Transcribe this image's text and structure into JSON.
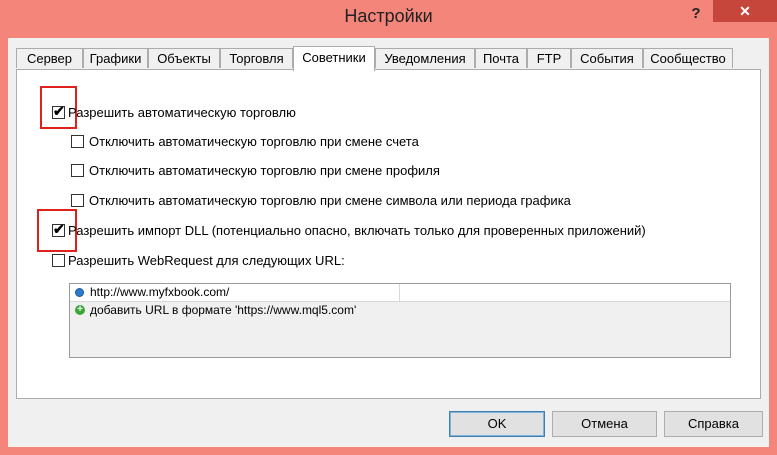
{
  "window": {
    "title": "Настройки",
    "help_label": "?",
    "close_label": "✕"
  },
  "tabs": [
    {
      "label": "Сервер"
    },
    {
      "label": "Графики"
    },
    {
      "label": "Объекты"
    },
    {
      "label": "Торговля"
    },
    {
      "label": "Советники",
      "active": true
    },
    {
      "label": "Уведомления"
    },
    {
      "label": "Почта"
    },
    {
      "label": "FTP"
    },
    {
      "label": "События"
    },
    {
      "label": "Сообщество"
    }
  ],
  "options": {
    "allow_auto": {
      "label": "Разрешить автоматическую торговлю",
      "checked": true
    },
    "disable_account": {
      "label": "Отключить автоматическую торговлю при смене счета",
      "checked": false
    },
    "disable_profile": {
      "label": "Отключить автоматическую торговлю при смене профиля",
      "checked": false
    },
    "disable_symbol": {
      "label": "Отключить автоматическую торговлю при смене символа или периода графика",
      "checked": false
    },
    "allow_dll": {
      "label": "Разрешить импорт DLL (потенциально опасно, включать только для проверенных приложений)",
      "checked": true
    },
    "allow_webrequest": {
      "label": "Разрешить WebRequest для следующих URL:",
      "checked": false
    }
  },
  "url_list": {
    "items": [
      "http://www.myfxbook.com/"
    ],
    "add_hint": "добавить URL в формате 'https://www.mql5.com'"
  },
  "buttons": {
    "ok": "OK",
    "cancel": "Отмена",
    "help": "Справка"
  },
  "colors": {
    "titlebar": "#f4857a",
    "close": "#c7463c",
    "highlight": "#e0201a"
  }
}
